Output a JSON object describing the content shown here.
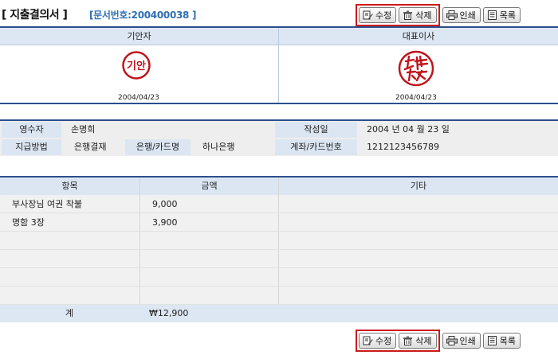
{
  "header": {
    "title": "[ 지출결의서 ]",
    "doc_number": "[문서번호:200400038 ]"
  },
  "buttons": {
    "edit": "수정",
    "delete": "삭제",
    "print": "인쇄",
    "list": "목록"
  },
  "approval": {
    "col1_title": "기안자",
    "col2_title": "대표이사",
    "seal1_text": "기안",
    "date1": "2004/04/23",
    "date2": "2004/04/23"
  },
  "info": {
    "receiver_label": "영수자",
    "receiver_value": "손명희",
    "written_label": "작성일",
    "written_value": "2004 년 04 월 23 일",
    "pay_method_label": "지급방법",
    "pay_method_value": "은행결재",
    "bank_label": "은행/카드명",
    "bank_value": "하나은행",
    "account_label": "계좌/카드번호",
    "account_value": "1212123456789"
  },
  "items": {
    "headers": [
      "항목",
      "금액",
      "기타"
    ],
    "rows": [
      {
        "item": "부사장님 여권 착불",
        "amount": "9,000",
        "note": ""
      },
      {
        "item": "명함 3장",
        "amount": "3,900",
        "note": ""
      }
    ],
    "total_label": "계",
    "total_value": "₩12,900"
  },
  "colors": {
    "accent": "#2b4f8c",
    "doc_number": "#2f6fb5",
    "header_bg": "#dce6f3",
    "seal_red": "#c0141c",
    "highlight_box": "#cc1a1a"
  },
  "icons": [
    "edit-icon",
    "trash-icon",
    "printer-icon",
    "list-icon"
  ]
}
